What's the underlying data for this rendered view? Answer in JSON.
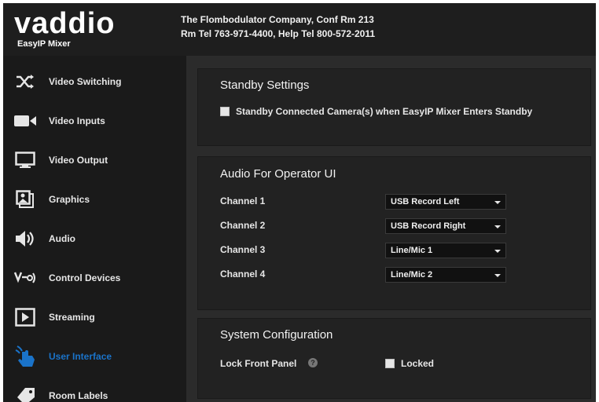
{
  "header": {
    "logo_text": "vaddio",
    "logo_subtitle": "EasyIP Mixer",
    "company_line1": "The Flombodulator Company, Conf Rm 213",
    "company_line2": "Rm Tel 763-971-4400, Help Tel 800-572-2011"
  },
  "sidebar": {
    "items": [
      {
        "label": "Video Switching",
        "icon": "shuffle-icon"
      },
      {
        "label": "Video Inputs",
        "icon": "video-camera-icon"
      },
      {
        "label": "Video Output",
        "icon": "monitor-icon"
      },
      {
        "label": "Graphics",
        "icon": "graphics-icon"
      },
      {
        "label": "Audio",
        "icon": "speaker-icon"
      },
      {
        "label": "Control Devices",
        "icon": "control-devices-icon"
      },
      {
        "label": "Streaming",
        "icon": "play-icon"
      },
      {
        "label": "User Interface",
        "icon": "pointer-hand-icon",
        "active": true
      },
      {
        "label": "Room Labels",
        "icon": "tag-icon"
      }
    ]
  },
  "standby": {
    "title": "Standby Settings",
    "checkbox_label": "Standby Connected Camera(s) when EasyIP Mixer Enters Standby",
    "checked": false
  },
  "audio": {
    "title": "Audio For Operator UI",
    "channels": [
      {
        "label": "Channel 1",
        "value": "USB Record Left"
      },
      {
        "label": "Channel 2",
        "value": "USB Record Right"
      },
      {
        "label": "Channel 3",
        "value": "Line/Mic 1"
      },
      {
        "label": "Channel 4",
        "value": "Line/Mic 2"
      }
    ]
  },
  "system": {
    "title": "System Configuration",
    "lock_label": "Lock Front Panel",
    "lock_value": "Locked",
    "lock_checked": false
  },
  "colors": {
    "accent": "#1a73c9",
    "background": "#2b2b2b",
    "panel": "#222222",
    "sidebar": "#1a1a1a"
  }
}
